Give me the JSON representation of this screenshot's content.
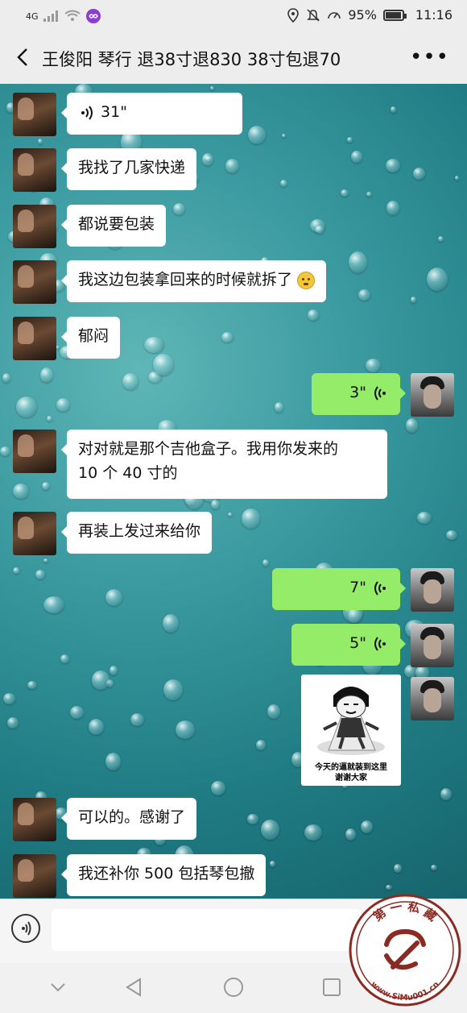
{
  "status_bar": {
    "network": "4G",
    "battery": "95%",
    "battery_level": 0.95,
    "time": "11:16"
  },
  "header": {
    "title": "王俊阳  琴行   退38寸退830  38寸包退70",
    "more": "•••"
  },
  "messages": [
    {
      "dir": "in",
      "type": "voice",
      "duration": "31\""
    },
    {
      "dir": "in",
      "type": "text",
      "text": "我找了几家快递"
    },
    {
      "dir": "in",
      "type": "text",
      "text": "都说要包装"
    },
    {
      "dir": "in",
      "type": "text",
      "text": "我这边包装拿回来的时候就拆了",
      "emoji": "worried-face"
    },
    {
      "dir": "in",
      "type": "text",
      "text": "郁闷"
    },
    {
      "dir": "out",
      "type": "voice",
      "duration": "3\""
    },
    {
      "dir": "in",
      "type": "text",
      "text": "对对就是那个吉他盒子。我用你发来的",
      "text2": "10 个 40 寸的"
    },
    {
      "dir": "in",
      "type": "text",
      "text": "再装上发过来给你"
    },
    {
      "dir": "out",
      "type": "voice",
      "duration": "7\""
    },
    {
      "dir": "out",
      "type": "voice",
      "duration": "5\""
    },
    {
      "dir": "out",
      "type": "sticker",
      "caption1": "今天的逼就装到这里",
      "caption2": "谢谢大家"
    },
    {
      "dir": "in",
      "type": "text",
      "text": "可以的。感谢了"
    },
    {
      "dir": "in",
      "type": "text",
      "text": "我还补你 500 包括琴包撤"
    }
  ],
  "input": {
    "placeholder": ""
  },
  "watermark": {
    "text_top": "第 一 私 藏",
    "url": "www.SiMu001.cn"
  },
  "colors": {
    "bubble_out": "#95ec69",
    "bubble_in": "#ffffff",
    "header_bg": "#ededed"
  }
}
